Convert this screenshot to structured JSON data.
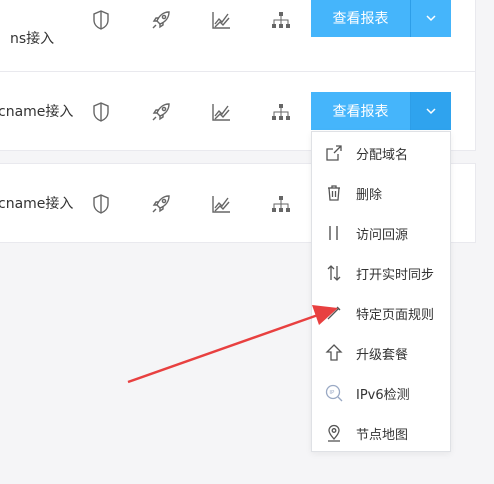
{
  "rows": [
    {
      "type_label": "ns接入",
      "report_label": "查看报表"
    },
    {
      "type_label": "cname接入",
      "report_label": "查看报表"
    },
    {
      "type_label": "cname接入"
    }
  ],
  "icons": [
    "shield-icon",
    "rocket-icon",
    "trend-chart-icon",
    "sitemap-icon",
    "chevron-down-icon"
  ],
  "dropdown": {
    "items": [
      {
        "label": "分配域名",
        "icon": "share-icon"
      },
      {
        "label": "删除",
        "icon": "trash-icon"
      },
      {
        "label": "访问回源",
        "icon": "origin-icon"
      },
      {
        "label": "打开实时同步",
        "icon": "sync-icon"
      },
      {
        "label": "特定页面规则",
        "icon": "pen-icon"
      },
      {
        "label": "升级套餐",
        "icon": "upgrade-arrow-icon"
      },
      {
        "label": "IPv6检测",
        "icon": "ipv6-search-icon"
      },
      {
        "label": "节点地图",
        "icon": "map-pin-icon"
      }
    ]
  },
  "colors": {
    "accent": "#45b5fb",
    "accent_active": "#2fa3ee",
    "annotation_arrow": "#e84040"
  }
}
